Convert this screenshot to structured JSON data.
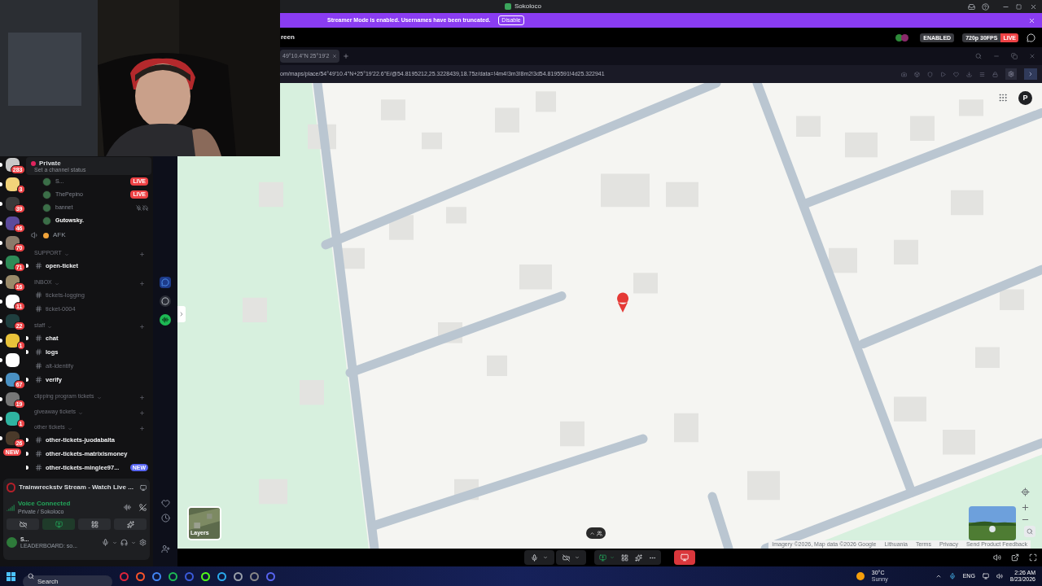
{
  "window": {
    "title": "Sokoloco"
  },
  "banner": {
    "text": "Streamer Mode is enabled. Usernames have been truncated.",
    "button": "Disable"
  },
  "stream_header": {
    "title": "reen",
    "badges": [
      {
        "kind": "status",
        "text": "ENABLED"
      },
      {
        "kind": "quality",
        "text": "720p 30FPS"
      },
      {
        "kind": "live",
        "text": "LIVE"
      }
    ]
  },
  "browser": {
    "tabs": [
      {
        "label": "49°10.4\"N 25°19'2",
        "selected": true
      }
    ],
    "url": "om/maps/place/54°49'10.4\"N+25°19'22.6\"E/@54.8195212,25.3228439,18.75z/data=!4m4!3m3!8m2!3d54.8195591!4d25.322941"
  },
  "map": {
    "avatar": "P",
    "layers_label": "Layers",
    "footer": [
      "Imagery ©2026, Map data ©2026 Google",
      "Lithuania",
      "Terms",
      "Privacy",
      "Send Product Feedback"
    ]
  },
  "servers": [
    {
      "unread": true,
      "badge": "283"
    },
    {
      "unread": true,
      "badge": "3"
    },
    {
      "unread": true,
      "badge": "39"
    },
    {
      "unread": true,
      "badge": "46"
    },
    {
      "unread": true,
      "badge": "70"
    },
    {
      "unread": true,
      "badge": "71"
    },
    {
      "unread": true,
      "badge": "16"
    },
    {
      "unread": true,
      "badge": "11"
    },
    {
      "unread": true,
      "badge": "22"
    },
    {
      "unread": true,
      "badge": "1"
    },
    {
      "unread": true
    },
    {
      "unread": true,
      "badge": "67"
    },
    {
      "unread": true,
      "badge": "19"
    },
    {
      "unread": true,
      "badge": "1"
    },
    {
      "unread": true,
      "badge": "26"
    }
  ],
  "new_pill": "NEW",
  "channels": [
    {
      "kind": "voice_channel",
      "name": "Private",
      "status": "Set a channel status"
    },
    {
      "kind": "user",
      "name": "S...",
      "badge": "LIVE",
      "muted": false,
      "active": false
    },
    {
      "kind": "user",
      "name": "ThePepino",
      "badge": "LIVE",
      "muted": false,
      "active": false
    },
    {
      "kind": "user",
      "name": "bannet",
      "muted": true,
      "active": false
    },
    {
      "kind": "user",
      "name": "Gutowsky.",
      "muted": false,
      "active": true
    },
    {
      "kind": "voice",
      "name": "AFK"
    },
    {
      "kind": "category",
      "name": "SUPPORT"
    },
    {
      "kind": "text",
      "name": "open-ticket",
      "unread": true
    },
    {
      "kind": "category",
      "name": "INBOX"
    },
    {
      "kind": "text",
      "name": "tickets-logging",
      "unread": false
    },
    {
      "kind": "text",
      "name": "ticket-0004",
      "unread": false
    },
    {
      "kind": "category",
      "name": "staff"
    },
    {
      "kind": "text",
      "name": "chat",
      "unread": true
    },
    {
      "kind": "text",
      "name": "logs",
      "unread": true
    },
    {
      "kind": "text",
      "name": "alt-identify",
      "unread": false
    },
    {
      "kind": "text",
      "name": "verify",
      "unread": true
    },
    {
      "kind": "category",
      "name": "clipping program tickets"
    },
    {
      "kind": "category",
      "name": "giveaway tickets"
    },
    {
      "kind": "category",
      "name": "other tickets"
    },
    {
      "kind": "text",
      "name": "other-tickets-juodabalta",
      "unread": true
    },
    {
      "kind": "text",
      "name": "other-tickets-matrixismoney",
      "unread": true
    },
    {
      "kind": "text",
      "name": "other-tickets-minglee97...",
      "unread": true,
      "badge": "NEW"
    }
  ],
  "activity": {
    "title": "Trainwreckstv Stream - Watch Live ..."
  },
  "voice": {
    "status": "Voice Connected",
    "channel": "Private / Sokoloco"
  },
  "voice_buttons": [
    {
      "kind": "camera",
      "active": false
    },
    {
      "kind": "share",
      "active": true
    },
    {
      "kind": "activities",
      "active": false
    },
    {
      "kind": "soundboard",
      "active": false
    }
  ],
  "user": {
    "name": "S...",
    "status": "LEADERBOARD: so..."
  },
  "stream_controls": {
    "camera_on": false,
    "sharing": true
  },
  "taskbar": {
    "search_placeholder": "Search",
    "temperature": "30°C",
    "weather": "Sunny",
    "language": "ENG",
    "time": "2:26 AM",
    "date": "8/23/2026"
  }
}
